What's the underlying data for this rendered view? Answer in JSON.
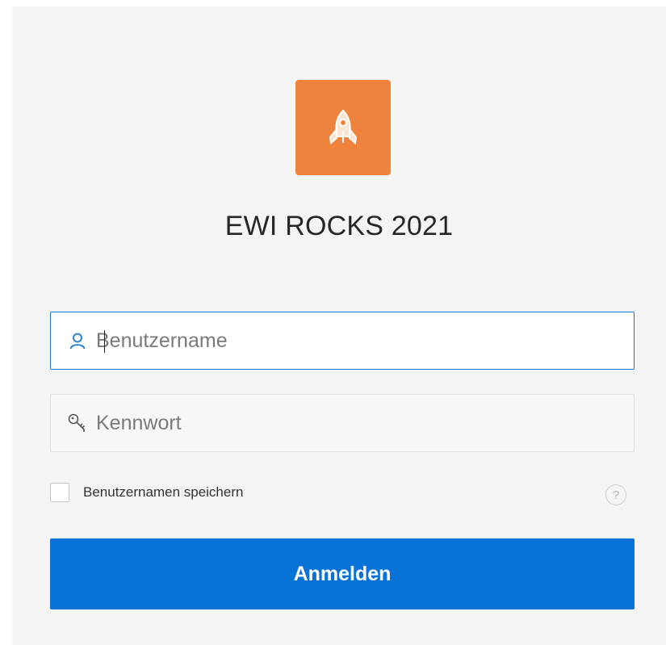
{
  "app": {
    "title": "EWI ROCKS 2021",
    "logo_icon": "rocket-icon",
    "logo_color": "#ee833d"
  },
  "form": {
    "username": {
      "placeholder": "Benutzername",
      "value": "",
      "icon": "user-icon",
      "focused": true
    },
    "password": {
      "placeholder": "Kennwort",
      "value": "",
      "icon": "key-icon"
    },
    "remember": {
      "label": "Benutzernamen speichern",
      "checked": false
    },
    "help_glyph": "?",
    "submit_label": "Anmelden"
  },
  "colors": {
    "accent": "#0773d6",
    "focus_border": "#1a78d6",
    "background": "#f4f4f4"
  }
}
